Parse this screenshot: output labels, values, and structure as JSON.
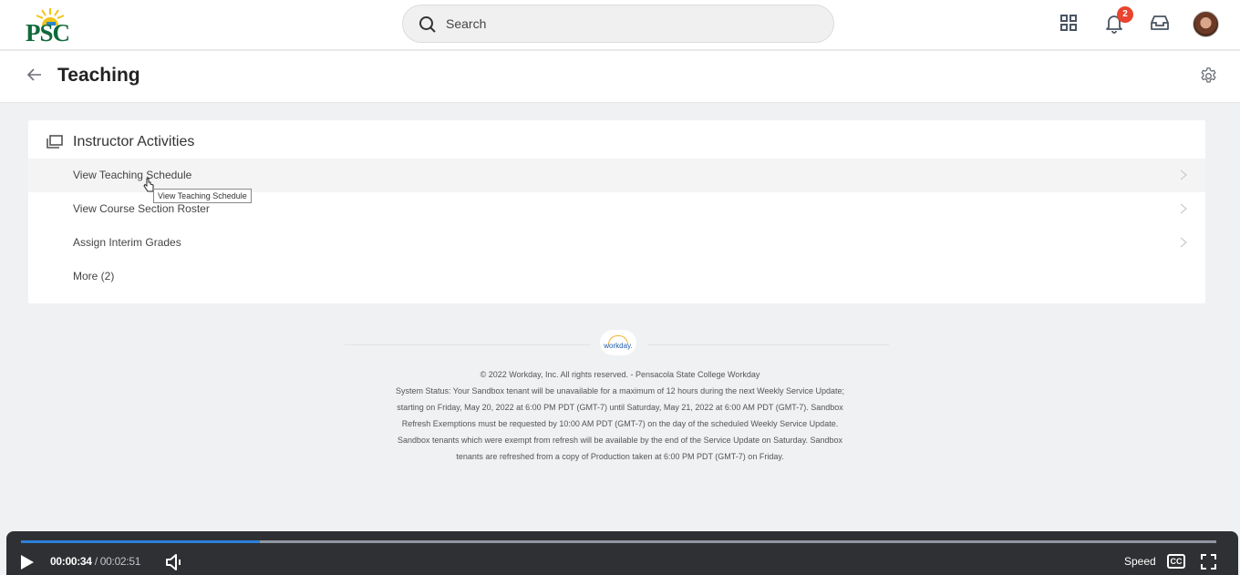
{
  "header": {
    "logo_text": "PSC",
    "search": {
      "placeholder": "Search",
      "value": ""
    },
    "notifications_count": "2",
    "icons": [
      "apps-grid-icon",
      "bell-icon",
      "inbox-icon",
      "avatar"
    ]
  },
  "page": {
    "title": "Teaching"
  },
  "card": {
    "title": "Instructor Activities",
    "items": [
      {
        "label": "View Teaching Schedule",
        "has_chevron": true
      },
      {
        "label": "View Course Section Roster",
        "has_chevron": true
      },
      {
        "label": "Assign Interim Grades",
        "has_chevron": true
      },
      {
        "label": "More (2)",
        "has_chevron": false
      }
    ],
    "tooltip": "View Teaching Schedule"
  },
  "footer": {
    "logo_text": "workday.",
    "copyright": "© 2022 Workday, Inc. All rights reserved. - Pensacola State College Workday",
    "status_lines": [
      "System Status: Your Sandbox tenant will be unavailable for a maximum of 12 hours during the next Weekly Service Update;",
      "starting on Friday, May 20, 2022 at 6:00 PM PDT (GMT-7) until Saturday, May 21, 2022 at 6:00 AM PDT (GMT-7). Sandbox",
      "Refresh Exemptions must be requested by 10:00 AM PDT (GMT-7) on the day of the scheduled Weekly Service Update.",
      "Sandbox tenants which were exempt from refresh will be available by the end of the Service Update on Saturday. Sandbox",
      "tenants are refreshed from a copy of Production taken at 6:00 PM PDT (GMT-7) on Friday."
    ]
  },
  "video": {
    "current_time": "00:00:34",
    "separator": "/",
    "total_time": "00:02:51",
    "progress": 0.2,
    "speed_label": "Speed",
    "cc_label": "CC",
    "colors": {
      "progress": "#2d7fdb",
      "track": "#8f96a3",
      "bar": "#2f3033"
    }
  }
}
